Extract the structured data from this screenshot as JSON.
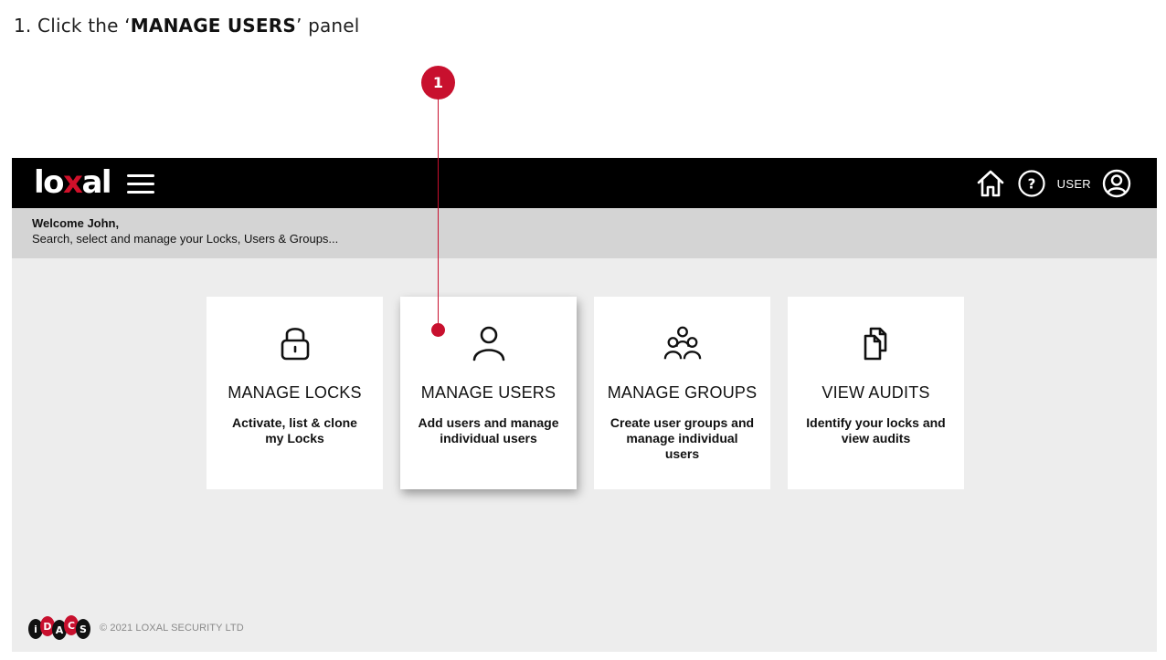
{
  "instruction": {
    "prefix": "1. Click the ‘",
    "target": "MANAGE USERS",
    "suffix": "’ panel"
  },
  "header": {
    "logo_prefix": "lo",
    "logo_x": "x",
    "logo_suffix": "al",
    "user_label": "USER"
  },
  "welcome": {
    "greeting": "Welcome John,",
    "subtitle": "Search, select and manage your Locks, Users & Groups..."
  },
  "cards": [
    {
      "title": "MANAGE LOCKS",
      "desc": "Activate, list & clone my Locks",
      "icon": "padlock-icon"
    },
    {
      "title": "MANAGE USERS",
      "desc": "Add users and manage individual users",
      "icon": "user-icon"
    },
    {
      "title": "MANAGE GROUPS",
      "desc": "Create user groups and manage individual users",
      "icon": "group-icon"
    },
    {
      "title": "VIEW AUDITS",
      "desc": "Identify your locks and view audits",
      "icon": "documents-icon"
    }
  ],
  "footer": {
    "logo_letters": [
      "i",
      "D",
      "A",
      "C",
      "S"
    ],
    "copyright": "© 2021 LOXAL SECURITY LTD"
  },
  "callout": {
    "number": "1"
  },
  "colors": {
    "accent": "#c8102e",
    "topbar": "#000000",
    "welcome_bar": "#d4d4d4",
    "background": "#ededed"
  }
}
